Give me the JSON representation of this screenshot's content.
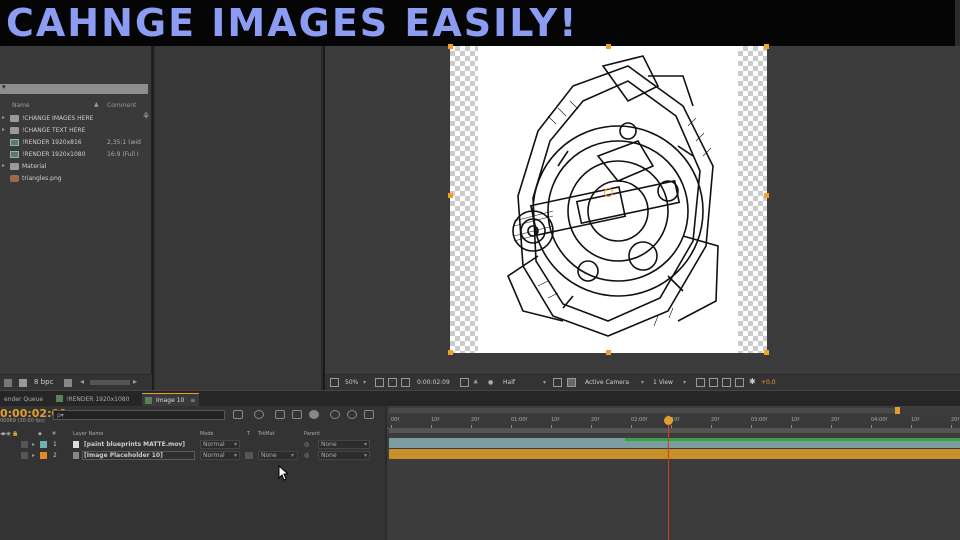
{
  "title": "CAHNGE IMAGES EASILY!",
  "project": {
    "columns": {
      "name": "Name",
      "comment": "Comment"
    },
    "items": [
      {
        "type": "folder",
        "name": "!CHANGE IMAGES HERE",
        "comment": ""
      },
      {
        "type": "folder",
        "name": "!CHANGE TEXT HERE",
        "comment": ""
      },
      {
        "type": "comp",
        "name": "!RENDER 1920x816",
        "comment": "2,35:1 (wid"
      },
      {
        "type": "comp",
        "name": "!RENDER 1920x1080",
        "comment": "16:9 (Full I"
      },
      {
        "type": "folder",
        "name": "Material",
        "comment": ""
      },
      {
        "type": "image",
        "name": "triangles.png",
        "comment": ""
      }
    ],
    "bpc": "8 bpc"
  },
  "viewer": {
    "zoom": "50%",
    "timecode": "0:00:02:09",
    "resolution": "Half",
    "camera": "Active Camera",
    "views": "1 View",
    "exposure": "+0,0"
  },
  "tabs": [
    {
      "label": "ender Queue",
      "active": false
    },
    {
      "label": "!RENDER 1920x1080",
      "active": false
    },
    {
      "label": "Image 10",
      "active": true
    }
  ],
  "timeline": {
    "timecode": "0:00:02:09",
    "timecode_sub": "00069 (30.00 fps)",
    "search_placeholder": "ρ▾",
    "columns": {
      "layer_name": "Layer Name",
      "mode": "Mode",
      "t": "T",
      "trkmat": "TrkMat",
      "parent": "Parent"
    },
    "layers": [
      {
        "num": "1",
        "name": "[paint blueprints MATTE.mov]",
        "mode": "Normal",
        "trkmat": "",
        "parent": "None",
        "color": "#6fb0b0"
      },
      {
        "num": "2",
        "name": "[Image Placeholder 10]",
        "mode": "Normal",
        "trkmat": "None",
        "parent": "None",
        "color": "#e08a20"
      }
    ],
    "ruler_ticks": [
      "00f",
      "10f",
      "20f",
      "01:00f",
      "10f",
      "20f",
      "02:00f",
      "10f",
      "20f",
      "03:00f",
      "10f",
      "20f",
      "04:00f",
      "10f",
      "20f"
    ]
  },
  "colors": {
    "title_text": "#8c9cf2",
    "accent": "#e0a030",
    "playhead": "#d04020"
  }
}
